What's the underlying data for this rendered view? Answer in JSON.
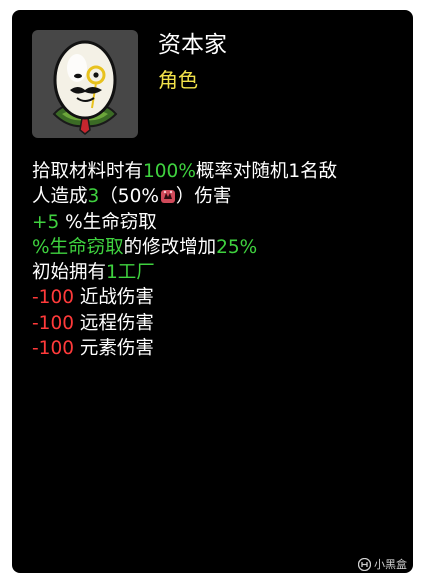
{
  "card": {
    "title": "资本家",
    "subtitle": "角色",
    "portrait_icon": "egg-capitalist-icon",
    "lines": {
      "l1_a": "拾取材料时有",
      "l1_b": "100%",
      "l1_c": "概率对随机1名敌",
      "l2_a": "人造成",
      "l2_b": "3",
      "l2_c": "（50%",
      "l2_d": "）伤害",
      "l3_a": "+5",
      "l3_b": " %生命窃取",
      "l4_a": "%生命窃取",
      "l4_b": "的修改增加",
      "l4_c": "25%",
      "l5_a": "初始拥有",
      "l5_b": "1工厂",
      "l6_a": "-100",
      "l6_b": " 近战伤害",
      "l7_a": "-100",
      "l7_b": " 远程伤害",
      "l8_a": "-100",
      "l8_b": " 元素伤害"
    },
    "inline_icon": "ranged-damage-icon"
  },
  "watermark": {
    "text": "小黑盒",
    "icon": "heybox-logo-icon"
  },
  "colors": {
    "background": "#000000",
    "subtitle": "#f2e24a",
    "positive": "#3fd23f",
    "negative": "#ff3a3a"
  }
}
